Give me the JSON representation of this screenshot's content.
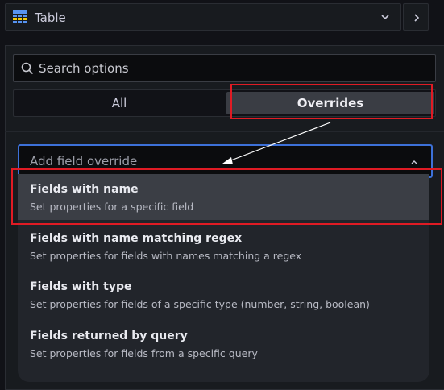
{
  "header": {
    "visualization_title": "Table",
    "icons": {
      "visualization": "table-icon",
      "picker": "chevron-down-icon",
      "next": "chevron-right-icon"
    }
  },
  "options": {
    "search_placeholder": "Search options",
    "tabs": [
      {
        "label": "All",
        "active": false
      },
      {
        "label": "Overrides",
        "active": true
      }
    ]
  },
  "override_select": {
    "placeholder": "Add field override",
    "expanded": true,
    "items": [
      {
        "title": "Fields with name",
        "description": "Set properties for a specific field",
        "highlighted": true
      },
      {
        "title": "Fields with name matching regex",
        "description": "Set properties for fields with names matching a regex",
        "highlighted": false
      },
      {
        "title": "Fields with type",
        "description": "Set properties for fields of a specific type (number, string, boolean)",
        "highlighted": false
      },
      {
        "title": "Fields returned by query",
        "description": "Set properties for fields from a specific query",
        "highlighted": false
      }
    ]
  },
  "colors": {
    "accent_focus": "#3d71d9",
    "annotation_red": "#e01b24",
    "background": "#111217",
    "panel": "#181b1f"
  }
}
